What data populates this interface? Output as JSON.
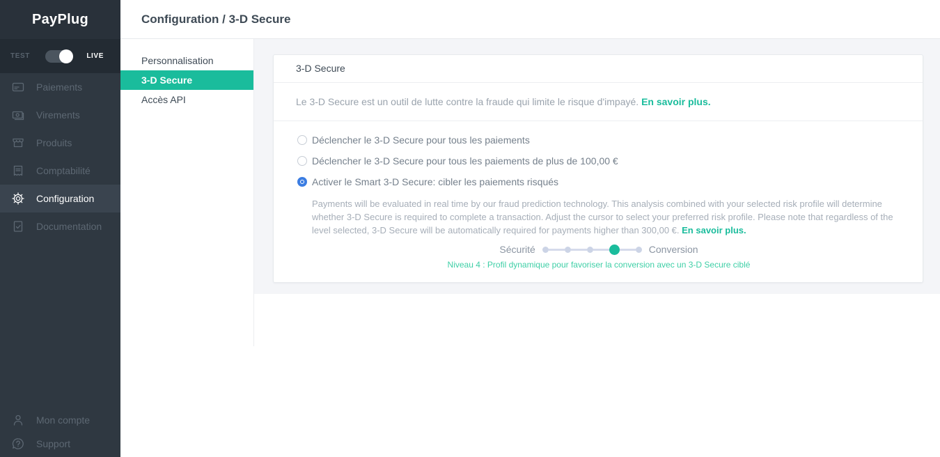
{
  "brand": {
    "logo": "PayPlug"
  },
  "env_toggle": {
    "test_label": "TEST",
    "live_label": "LIVE",
    "state": "live"
  },
  "sidebar": {
    "items": [
      {
        "label": "Paiements",
        "icon": "card-icon",
        "active": false
      },
      {
        "label": "Virements",
        "icon": "banknote-icon",
        "active": false
      },
      {
        "label": "Produits",
        "icon": "storefront-icon",
        "active": false
      },
      {
        "label": "Comptabilité",
        "icon": "receipt-icon",
        "active": false
      },
      {
        "label": "Configuration",
        "icon": "gear-icon",
        "active": true
      },
      {
        "label": "Documentation",
        "icon": "document-check-icon",
        "active": false
      }
    ],
    "bottom_items": [
      {
        "label": "Mon compte",
        "icon": "user-icon"
      },
      {
        "label": "Support",
        "icon": "help-bubble-icon"
      }
    ]
  },
  "header": {
    "title": "Configuration / 3-D Secure"
  },
  "subnav": {
    "items": [
      {
        "label": "Personnalisation",
        "active": false
      },
      {
        "label": "3-D Secure",
        "active": true
      },
      {
        "label": "Accès API",
        "active": false
      }
    ]
  },
  "card": {
    "title": "3-D Secure",
    "intro": "Le 3-D Secure est un outil de lutte contre la fraude qui limite le risque d'impayé.",
    "learn_more": "En savoir plus.",
    "options": [
      {
        "label": "Déclencher le 3-D Secure pour tous les paiements",
        "selected": false
      },
      {
        "label": "Déclencher le 3-D Secure pour tous les paiements de plus de 100,00 €",
        "selected": false
      },
      {
        "label": "Activer le Smart 3-D Secure: cibler les paiements risqués",
        "selected": true
      }
    ],
    "smart_description": "Payments will be evaluated in real time by our fraud prediction technology. This analysis combined with your selected risk profile will determine whether 3-D Secure is required to complete a transaction. Adjust the cursor to select your preferred risk profile. Please note that regardless of the level selected, 3-D Secure will be automatically required for payments higher than 300,00 €.",
    "smart_learn_more": "En savoir plus.",
    "slider": {
      "left_label": "Sécurité",
      "right_label": "Conversion",
      "levels": 5,
      "selected_level": 4,
      "caption": "Niveau 4 : Profil dynamique pour favoriser la conversion avec un 3-D Secure ciblé"
    }
  },
  "colors": {
    "accent_green": "#1abc9c",
    "caption_green": "#3ecfa6",
    "radio_blue": "#3b7de2",
    "sidebar_dark": "#2f3841",
    "content_bg": "#f4f5f8"
  }
}
